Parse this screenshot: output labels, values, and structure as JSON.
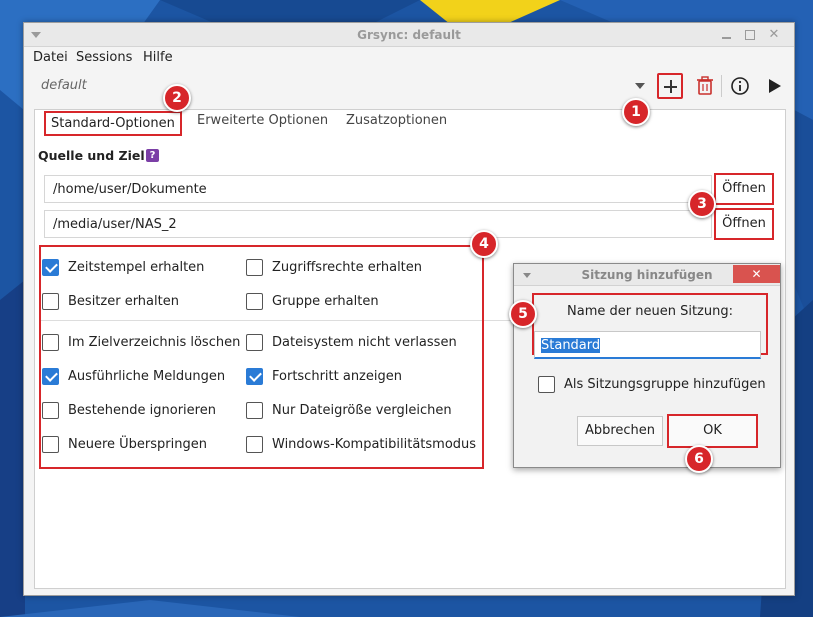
{
  "window": {
    "title": "Grsync: default",
    "close_glyph": "✕"
  },
  "menu": [
    "Datei",
    "Sessions",
    "Hilfe"
  ],
  "toolbar": {
    "session": "default",
    "icons": [
      "chevron-down-icon",
      "plus-icon",
      "trash-icon",
      "info-icon",
      "play-icon"
    ]
  },
  "tabs": [
    "Standard-Optionen",
    "Erweiterte Optionen",
    "Zusatzoptionen"
  ],
  "source_dest": {
    "label": "Quelle und Ziel:",
    "help_glyph": "?",
    "source": "/home/user/Dokumente",
    "destination": "/media/user/NAS_2",
    "open_label": "Öffnen"
  },
  "options": [
    {
      "label": "Zeitstempel erhalten",
      "checked": true
    },
    {
      "label": "Zugriffsrechte erhalten",
      "checked": false
    },
    {
      "label": "Besitzer erhalten",
      "checked": false
    },
    {
      "label": "Gruppe erhalten",
      "checked": false
    },
    {
      "label": "Im Zielverzeichnis löschen",
      "checked": false
    },
    {
      "label": "Dateisystem nicht verlassen",
      "checked": false
    },
    {
      "label": "Ausführliche Meldungen",
      "checked": true
    },
    {
      "label": "Fortschritt anzeigen",
      "checked": true
    },
    {
      "label": "Bestehende ignorieren",
      "checked": false
    },
    {
      "label": "Nur Dateigröße vergleichen",
      "checked": false
    },
    {
      "label": "Neuere Überspringen",
      "checked": false
    },
    {
      "label": "Windows-Kompatibilitätsmodus",
      "checked": false
    }
  ],
  "dialog": {
    "title": "Sitzung hinzufügen",
    "close_glyph": "✕",
    "prompt": "Name der neuen Sitzung:",
    "value": "Standard",
    "group_checkbox": {
      "label": "Als Sitzungsgruppe hinzufügen",
      "checked": false
    },
    "cancel": "Abbrechen",
    "ok": "OK"
  },
  "callouts": [
    "1",
    "2",
    "3",
    "4",
    "5",
    "6"
  ],
  "colors": {
    "highlight_red": "#d7262a",
    "check_blue": "#2a7bd6",
    "help_purple": "#7b3fa6",
    "trash_red": "#c9302c"
  }
}
